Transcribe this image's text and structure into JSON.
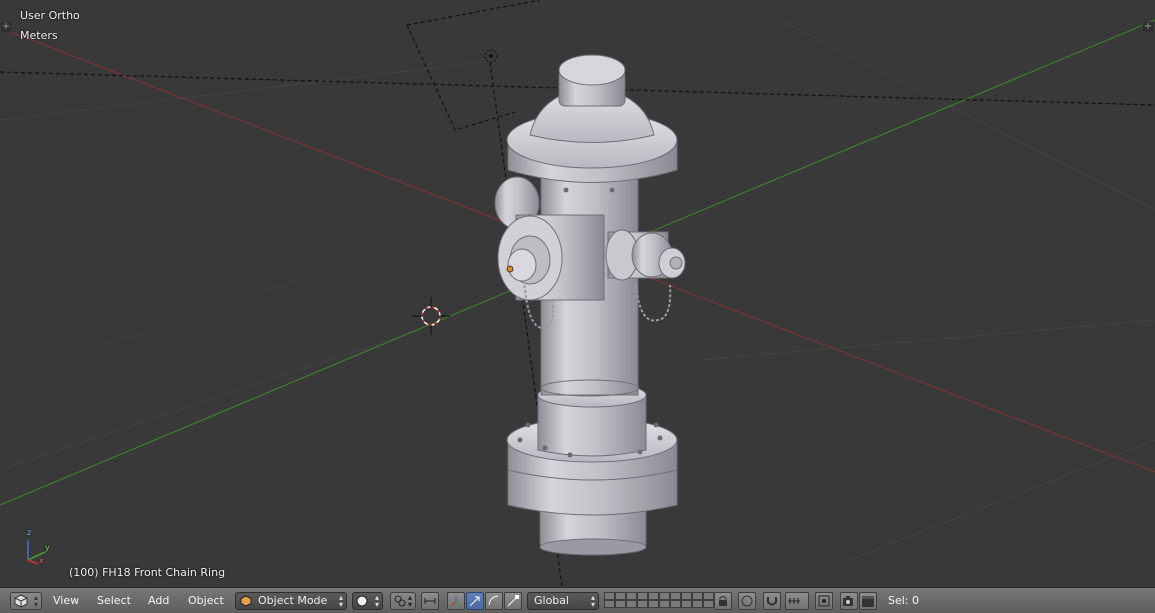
{
  "viewport": {
    "view_name": "User Ortho",
    "units": "Meters",
    "object_info": "(100) FH18 Front Chain Ring",
    "axis_x": "x",
    "axis_y": "y",
    "axis_z": "z"
  },
  "header": {
    "menus": {
      "view": "View",
      "select": "Select",
      "add": "Add",
      "object": "Object"
    },
    "mode": "Object Mode",
    "orientation": "Global",
    "selection": "Sel: 0"
  },
  "colors": {
    "background": "#393939",
    "x_axis": "#8a3434",
    "y_axis": "#3d8a2c",
    "header": "#727272",
    "accent_blue": "#4a6aa0",
    "origin": "#e08a2a"
  },
  "icons": {
    "editor_type": "cube-icon",
    "shading": "sphere-icon",
    "pivot": "pivot-icon",
    "manipulator": "manipulator-icon",
    "translate": "arrow-icon",
    "rotate": "arc-icon",
    "scale": "scale-icon",
    "render": "camera-icon"
  }
}
